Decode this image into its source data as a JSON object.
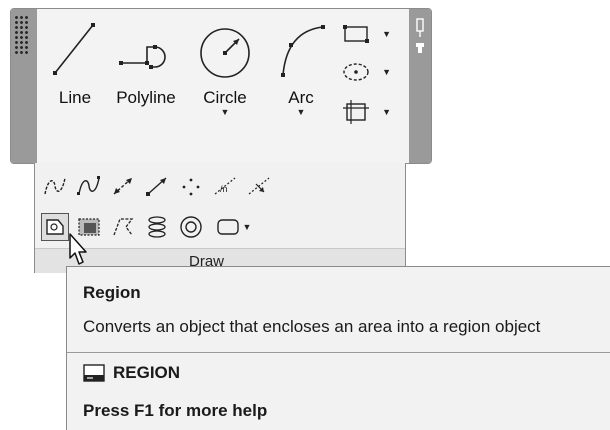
{
  "ribbon": {
    "big_tools": [
      {
        "label": "Line",
        "icon": "line-icon"
      },
      {
        "label": "Polyline",
        "icon": "polyline-icon"
      },
      {
        "label": "Circle",
        "icon": "circle-icon"
      },
      {
        "label": "Arc",
        "icon": "arc-icon"
      }
    ],
    "small_tools": [
      {
        "icon": "rectangle-icon"
      },
      {
        "icon": "ellipse-icon"
      },
      {
        "icon": "hatch-icon"
      }
    ],
    "panel_title": "Draw",
    "expanded_row1_icons": [
      "spline-fit-icon",
      "spline-cv-icon",
      "construction-line-icon",
      "ray-icon",
      "multiple-points-icon",
      "divide-icon",
      "measure-icon"
    ],
    "expanded_row2_icons": [
      "region-icon",
      "wipeout-icon",
      "3d-polyline-icon",
      "helix-icon",
      "donut-icon",
      "revision-cloud-icon"
    ]
  },
  "tooltip": {
    "title": "Region",
    "description": "Converts an object that encloses an area into a region object",
    "command": "REGION",
    "help": "Press F1 for more help"
  }
}
